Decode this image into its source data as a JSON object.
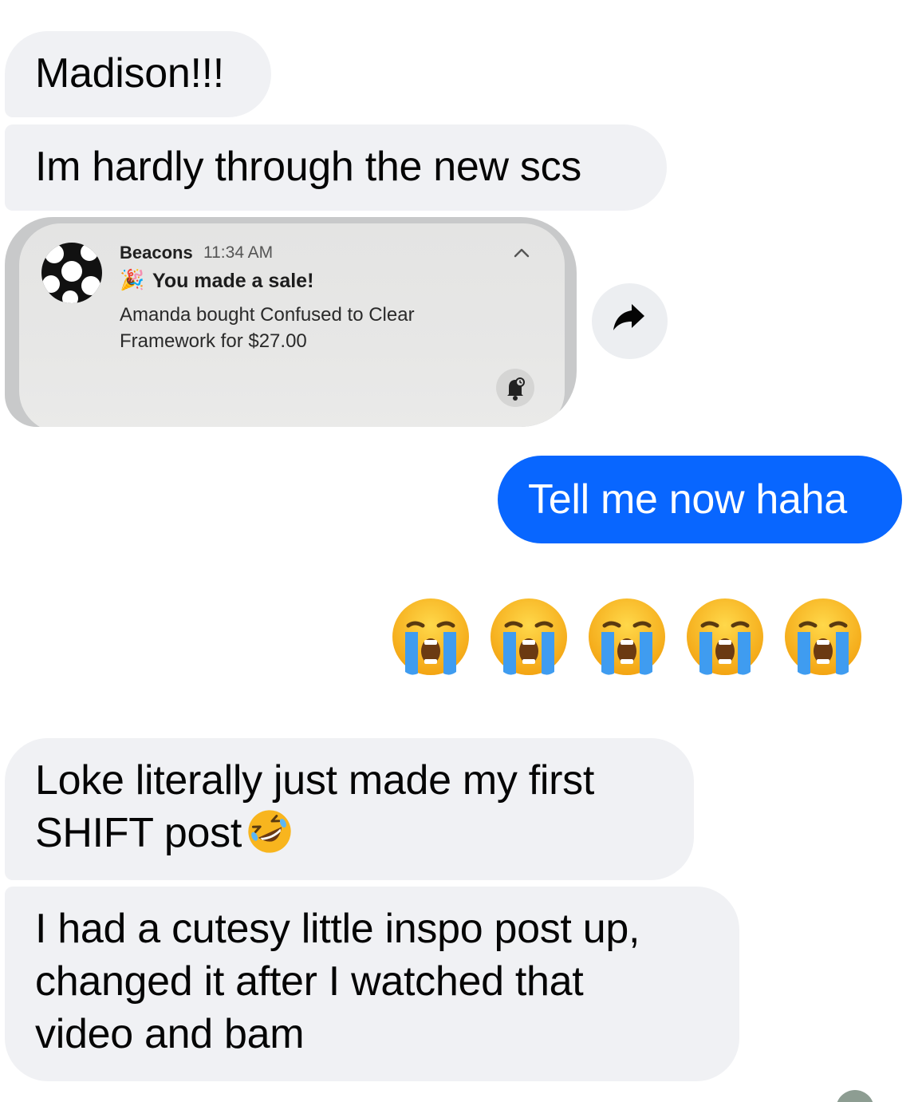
{
  "messages": {
    "m1": "Madison!!!",
    "m2": "Im hardly through the new scs",
    "sent": "Tell me now haha",
    "m3_line1": "Loke literally just made my first",
    "m3_line2": "SHIFT post",
    "m4_line1": "I had a cutesy little inspo post up,",
    "m4_line2": "changed it after I watched that",
    "m4_line3": "video and bam"
  },
  "notification": {
    "app": "Beacons",
    "time": "11:34 AM",
    "title": "You made a sale!",
    "body": "Amanda bought Confused to Clear Framework for $27.00",
    "title_emoji": "🎉"
  },
  "reaction_emojis": [
    "loudly-crying-face",
    "loudly-crying-face",
    "loudly-crying-face",
    "loudly-crying-face",
    "loudly-crying-face"
  ],
  "inline_emoji": "rolling-on-floor-laughing",
  "colors": {
    "received_bubble": "#f0f1f4",
    "sent_bubble": "#0866ff",
    "sent_text": "#ffffff"
  }
}
